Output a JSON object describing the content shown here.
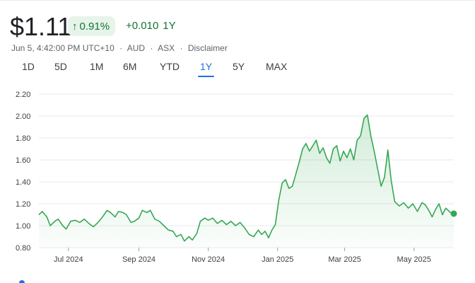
{
  "quote": {
    "price": "$1.11",
    "change_percent": "0.91%",
    "change_arrow": "↑",
    "change_abs": "+0.010",
    "change_period": "1Y",
    "timestamp": "Jun 5, 4:42:00 PM UTC+10",
    "currency": "AUD",
    "exchange": "ASX",
    "disclaimer": "Disclaimer",
    "sep": "·"
  },
  "range_tabs": [
    {
      "label": "1D",
      "active": false
    },
    {
      "label": "5D",
      "active": false
    },
    {
      "label": "1M",
      "active": false
    },
    {
      "label": "6M",
      "active": false
    },
    {
      "label": "YTD",
      "active": false
    },
    {
      "label": "1Y",
      "active": true
    },
    {
      "label": "5Y",
      "active": false
    },
    {
      "label": "MAX",
      "active": false
    }
  ],
  "colors": {
    "line": "#34a853",
    "fill_top": "#34a853",
    "grid": "#e8eaed",
    "positive": "#137333"
  },
  "chart_data": {
    "type": "area",
    "title": "",
    "xlabel": "",
    "ylabel": "",
    "ylim": [
      0.8,
      2.2
    ],
    "y_ticks": [
      "2.20",
      "2.00",
      "1.80",
      "1.60",
      "1.40",
      "1.20",
      "1.00",
      "0.80"
    ],
    "y_tick_values": [
      2.2,
      2.0,
      1.8,
      1.6,
      1.4,
      1.2,
      1.0,
      0.8
    ],
    "x_range": [
      "2024-06-05",
      "2025-06-05"
    ],
    "x_ticks": [
      {
        "label": "Jul 2024",
        "date": "2024-07-01"
      },
      {
        "label": "Sep 2024",
        "date": "2024-09-01"
      },
      {
        "label": "Nov 2024",
        "date": "2024-11-01"
      },
      {
        "label": "Jan 2025",
        "date": "2025-01-01"
      },
      {
        "label": "Mar 2025",
        "date": "2025-03-01"
      },
      {
        "label": "May 2025",
        "date": "2025-05-01"
      }
    ],
    "grid": true,
    "series": [
      {
        "points": [
          [
            "2024-06-05",
            1.1
          ],
          [
            "2024-06-08",
            1.13
          ],
          [
            "2024-06-12",
            1.08
          ],
          [
            "2024-06-15",
            1.0
          ],
          [
            "2024-06-19",
            1.04
          ],
          [
            "2024-06-22",
            1.06
          ],
          [
            "2024-06-26",
            1.0
          ],
          [
            "2024-06-29",
            0.97
          ],
          [
            "2024-07-03",
            1.04
          ],
          [
            "2024-07-07",
            1.05
          ],
          [
            "2024-07-11",
            1.03
          ],
          [
            "2024-07-15",
            1.06
          ],
          [
            "2024-07-19",
            1.02
          ],
          [
            "2024-07-23",
            0.99
          ],
          [
            "2024-07-27",
            1.03
          ],
          [
            "2024-07-31",
            1.08
          ],
          [
            "2024-08-04",
            1.14
          ],
          [
            "2024-08-07",
            1.12
          ],
          [
            "2024-08-11",
            1.08
          ],
          [
            "2024-08-14",
            1.13
          ],
          [
            "2024-08-18",
            1.12
          ],
          [
            "2024-08-21",
            1.1
          ],
          [
            "2024-08-25",
            1.03
          ],
          [
            "2024-08-28",
            1.04
          ],
          [
            "2024-09-01",
            1.07
          ],
          [
            "2024-09-04",
            1.14
          ],
          [
            "2024-09-08",
            1.12
          ],
          [
            "2024-09-11",
            1.14
          ],
          [
            "2024-09-15",
            1.06
          ],
          [
            "2024-09-19",
            1.04
          ],
          [
            "2024-09-23",
            1.0
          ],
          [
            "2024-09-27",
            0.96
          ],
          [
            "2024-10-01",
            0.95
          ],
          [
            "2024-10-04",
            0.9
          ],
          [
            "2024-10-08",
            0.92
          ],
          [
            "2024-10-11",
            0.86
          ],
          [
            "2024-10-15",
            0.9
          ],
          [
            "2024-10-18",
            0.87
          ],
          [
            "2024-10-22",
            0.93
          ],
          [
            "2024-10-25",
            1.04
          ],
          [
            "2024-10-29",
            1.07
          ],
          [
            "2024-11-01",
            1.05
          ],
          [
            "2024-11-05",
            1.07
          ],
          [
            "2024-11-09",
            1.02
          ],
          [
            "2024-11-13",
            1.05
          ],
          [
            "2024-11-17",
            1.01
          ],
          [
            "2024-11-21",
            1.04
          ],
          [
            "2024-11-25",
            1.0
          ],
          [
            "2024-11-29",
            1.03
          ],
          [
            "2024-12-03",
            0.98
          ],
          [
            "2024-12-07",
            0.92
          ],
          [
            "2024-12-11",
            0.9
          ],
          [
            "2024-12-15",
            0.96
          ],
          [
            "2024-12-18",
            0.92
          ],
          [
            "2024-12-21",
            0.95
          ],
          [
            "2024-12-24",
            0.89
          ],
          [
            "2024-12-27",
            0.96
          ],
          [
            "2024-12-30",
            1.01
          ],
          [
            "2025-01-02",
            1.23
          ],
          [
            "2025-01-05",
            1.39
          ],
          [
            "2025-01-08",
            1.42
          ],
          [
            "2025-01-11",
            1.34
          ],
          [
            "2025-01-14",
            1.36
          ],
          [
            "2025-01-17",
            1.47
          ],
          [
            "2025-01-20",
            1.58
          ],
          [
            "2025-01-23",
            1.7
          ],
          [
            "2025-01-26",
            1.75
          ],
          [
            "2025-01-29",
            1.68
          ],
          [
            "2025-02-01",
            1.73
          ],
          [
            "2025-02-04",
            1.78
          ],
          [
            "2025-02-07",
            1.66
          ],
          [
            "2025-02-10",
            1.71
          ],
          [
            "2025-02-13",
            1.62
          ],
          [
            "2025-02-16",
            1.57
          ],
          [
            "2025-02-19",
            1.7
          ],
          [
            "2025-02-22",
            1.73
          ],
          [
            "2025-02-25",
            1.59
          ],
          [
            "2025-02-28",
            1.68
          ],
          [
            "2025-03-03",
            1.62
          ],
          [
            "2025-03-06",
            1.7
          ],
          [
            "2025-03-09",
            1.6
          ],
          [
            "2025-03-12",
            1.78
          ],
          [
            "2025-03-15",
            1.82
          ],
          [
            "2025-03-18",
            1.98
          ],
          [
            "2025-03-21",
            2.01
          ],
          [
            "2025-03-24",
            1.82
          ],
          [
            "2025-03-27",
            1.68
          ],
          [
            "2025-03-30",
            1.52
          ],
          [
            "2025-04-02",
            1.36
          ],
          [
            "2025-04-05",
            1.44
          ],
          [
            "2025-04-08",
            1.69
          ],
          [
            "2025-04-11",
            1.41
          ],
          [
            "2025-04-14",
            1.22
          ],
          [
            "2025-04-18",
            1.18
          ],
          [
            "2025-04-22",
            1.21
          ],
          [
            "2025-04-26",
            1.16
          ],
          [
            "2025-04-30",
            1.2
          ],
          [
            "2025-05-04",
            1.13
          ],
          [
            "2025-05-08",
            1.21
          ],
          [
            "2025-05-11",
            1.19
          ],
          [
            "2025-05-14",
            1.14
          ],
          [
            "2025-05-17",
            1.08
          ],
          [
            "2025-05-20",
            1.15
          ],
          [
            "2025-05-23",
            1.2
          ],
          [
            "2025-05-26",
            1.1
          ],
          [
            "2025-05-29",
            1.16
          ],
          [
            "2025-06-02",
            1.12
          ],
          [
            "2025-06-05",
            1.11
          ]
        ]
      }
    ]
  }
}
